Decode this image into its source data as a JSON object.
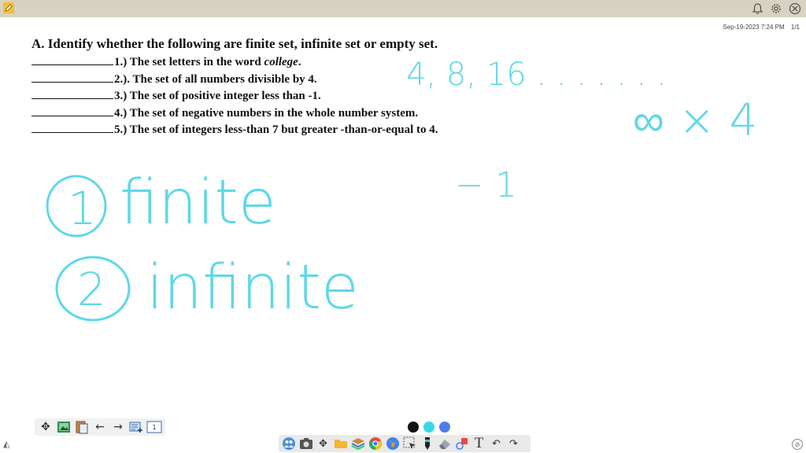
{
  "toolbar_top": {
    "icons": [
      "pencil-icon",
      "bell-icon",
      "gear-icon",
      "close-icon"
    ]
  },
  "timestamp": "Sep-19-2023 7:24 PM",
  "page_counter": "1/1",
  "worksheet": {
    "heading": "A. Identify whether the following are finite set, infinite set or empty set.",
    "items": [
      {
        "label": "1.)  The set letters in the word ",
        "emph": "college",
        "tail": "."
      },
      {
        "label": "2.). The set of all numbers divisible by 4.",
        "emph": "",
        "tail": ""
      },
      {
        "label": "3.) The set of positive integer less than -1.",
        "emph": "",
        "tail": ""
      },
      {
        "label": "4.) The set of negative numbers in the whole number system.",
        "emph": "",
        "tail": ""
      },
      {
        "label": "5.) The set of integers less-than 7  but greater -than-or-equal to 4.",
        "emph": "",
        "tail": ""
      }
    ]
  },
  "handwriting": {
    "color": "#5fd8e6",
    "sequence": "4, 8, 16 . . . . . . .",
    "infinity_times": "∞ × 4",
    "minus": "− 1",
    "answer1_num": "1",
    "answer1": "finite",
    "answer2_num": "2",
    "answer2": "infinite"
  },
  "left_toolbar": {
    "icons": [
      "move-icon",
      "image-edit-icon",
      "paste-icon",
      "arrow-left-icon",
      "arrow-right-icon",
      "add-page-icon",
      "page-number-icon"
    ],
    "page_number": "1"
  },
  "color_palette": [
    "#111111",
    "#36dbe6",
    "#4f7de6"
  ],
  "bottom_toolbar": {
    "icons": [
      "people-icon",
      "camera-icon",
      "move-cross-icon",
      "folder-icon",
      "layers-icon",
      "chrome-icon",
      "globe-icon",
      "select-icon",
      "pen-icon",
      "eraser-icon",
      "shapes-icon",
      "text-icon",
      "undo-icon",
      "redo-icon"
    ],
    "text_tool_label": "T"
  }
}
